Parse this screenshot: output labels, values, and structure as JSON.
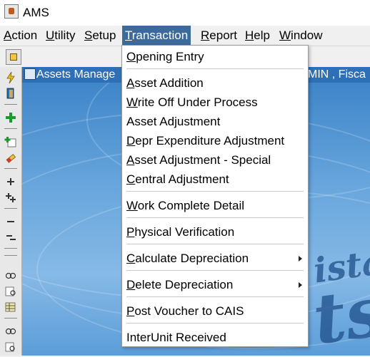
{
  "window": {
    "title": "AMS"
  },
  "menubar": {
    "items": [
      {
        "label": "Action",
        "mn": "A",
        "rest": "ction"
      },
      {
        "label": "Utility",
        "mn": "U",
        "rest": "tility"
      },
      {
        "label": "Setup",
        "mn": "S",
        "rest": "etup"
      },
      {
        "label": "Transaction",
        "mn": "T",
        "rest": "ransaction"
      },
      {
        "label": "Report",
        "mn": "R",
        "rest": "eport"
      },
      {
        "label": "Help",
        "mn": "H",
        "rest": "elp"
      },
      {
        "label": "Window",
        "mn": "W",
        "rest": "indow"
      }
    ],
    "active": "Transaction"
  },
  "inner_window": {
    "title": "Assets Manage",
    "title_right": "MIN , Fisca"
  },
  "background_text": {
    "word1": "ista",
    "word2": "ts"
  },
  "transaction_menu": {
    "items": [
      {
        "label": "Opening Entry",
        "mn": "O",
        "rest": "pening Entry",
        "submenu": false
      },
      {
        "label": "Asset Addition",
        "mn": "A",
        "rest": "sset Addition",
        "submenu": false
      },
      {
        "label": "Write Off Under Process",
        "mn": "W",
        "rest": "rite Off Under Process",
        "submenu": false
      },
      {
        "label": "Asset Adjustment",
        "mn": "",
        "rest": "Asset Adjustment",
        "submenu": false
      },
      {
        "label": "Depr Expenditure Adjustment",
        "mn": "D",
        "rest": "epr Expenditure Adjustment",
        "submenu": false
      },
      {
        "label": "Asset Adjustment - Special",
        "mn": "A",
        "rest": "sset Adjustment - Special",
        "submenu": false
      },
      {
        "label": "Central Adjustment",
        "mn": "C",
        "rest": "entral Adjustment",
        "submenu": false
      },
      {
        "label": "Work Complete Detail",
        "mn": "W",
        "rest": "ork Complete Detail",
        "submenu": false
      },
      {
        "label": "Physical Verification",
        "mn": "P",
        "rest": "hysical Verification",
        "submenu": false
      },
      {
        "label": "Calculate Depreciation",
        "mn": "C",
        "rest": "alculate Depreciation",
        "submenu": true
      },
      {
        "label": "Delete Depreciation",
        "mn": "D",
        "rest": "elete Depreciation",
        "submenu": true
      },
      {
        "label": "Post Voucher to CAIS",
        "mn": "P",
        "rest": "ost Voucher to CAIS",
        "submenu": false
      },
      {
        "label": "InterUnit Received",
        "mn": "",
        "rest": "InterUnit Received",
        "submenu": false
      }
    ]
  },
  "colors": {
    "menu_active_bg": "#3c6a9a",
    "inner_title_bg": "#2e6fb5",
    "inner_bg": "#4f91cf"
  }
}
